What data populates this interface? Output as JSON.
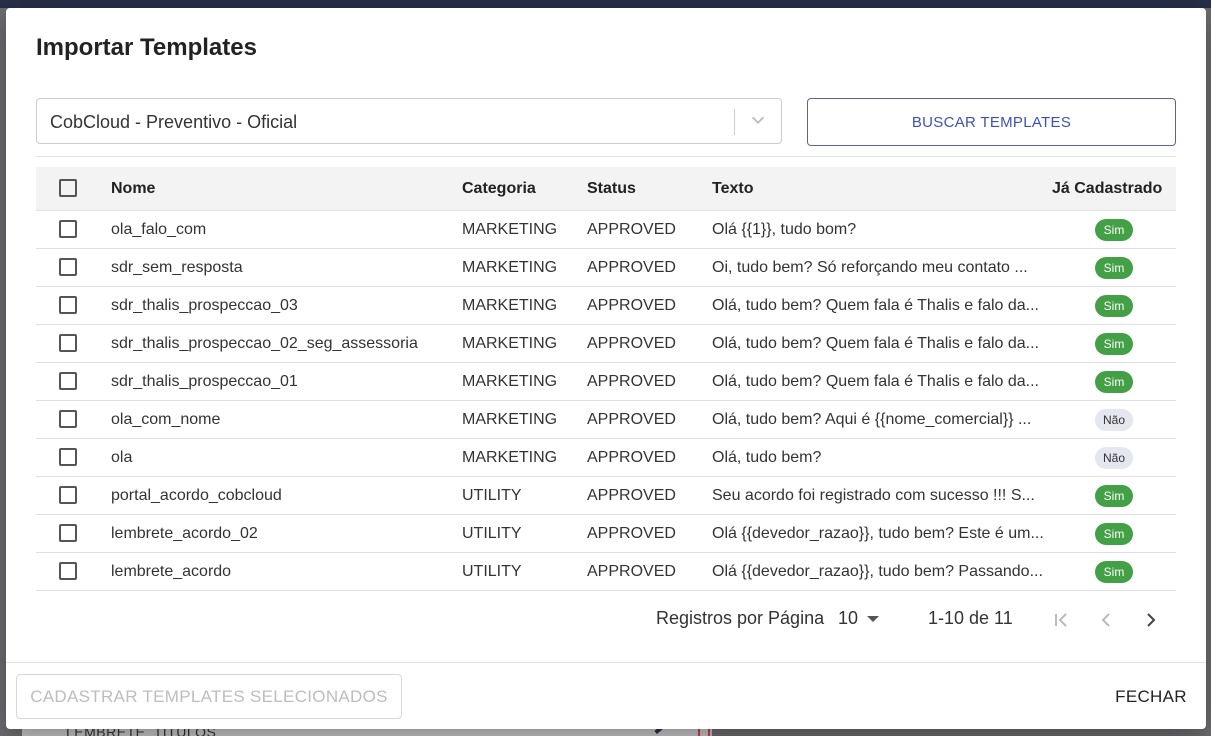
{
  "backdrop": {
    "peek_text": "LEMBRETE_TITULOS"
  },
  "dialog": {
    "title": "Importar Templates",
    "select": {
      "value": "CobCloud - Preventivo - Oficial"
    },
    "buscar_label": "BUSCAR TEMPLATES",
    "table": {
      "headers": {
        "nome": "Nome",
        "categoria": "Categoria",
        "status": "Status",
        "texto": "Texto",
        "cadastrado": "Já Cadastrado"
      },
      "rows": [
        {
          "nome": "ola_falo_com",
          "categoria": "MARKETING",
          "status": "APPROVED",
          "texto": "Olá {{1}}, tudo bom?",
          "cadastrado": "Sim"
        },
        {
          "nome": "sdr_sem_resposta",
          "categoria": "MARKETING",
          "status": "APPROVED",
          "texto": "Oi, tudo bem? Só reforçando meu contato ...",
          "cadastrado": "Sim"
        },
        {
          "nome": "sdr_thalis_prospeccao_03",
          "categoria": "MARKETING",
          "status": "APPROVED",
          "texto": "Olá, tudo bem? Quem fala é Thalis e falo da...",
          "cadastrado": "Sim"
        },
        {
          "nome": "sdr_thalis_prospeccao_02_seg_assessoria",
          "categoria": "MARKETING",
          "status": "APPROVED",
          "texto": "Olá, tudo bem? Quem fala é Thalis e falo da...",
          "cadastrado": "Sim"
        },
        {
          "nome": "sdr_thalis_prospeccao_01",
          "categoria": "MARKETING",
          "status": "APPROVED",
          "texto": "Olá, tudo bem? Quem fala é Thalis e falo da...",
          "cadastrado": "Sim"
        },
        {
          "nome": "ola_com_nome",
          "categoria": "MARKETING",
          "status": "APPROVED",
          "texto": "Olá, tudo bem? Aqui é {{nome_comercial}} ...",
          "cadastrado": "Não"
        },
        {
          "nome": "ola",
          "categoria": "MARKETING",
          "status": "APPROVED",
          "texto": "Olá, tudo bem?",
          "cadastrado": "Não"
        },
        {
          "nome": "portal_acordo_cobcloud",
          "categoria": "UTILITY",
          "status": "APPROVED",
          "texto": "Seu acordo foi registrado com sucesso !!! S...",
          "cadastrado": "Sim"
        },
        {
          "nome": "lembrete_acordo_02",
          "categoria": "UTILITY",
          "status": "APPROVED",
          "texto": "Olá {{devedor_razao}}, tudo bem? Este é um...",
          "cadastrado": "Sim"
        },
        {
          "nome": "lembrete_acordo",
          "categoria": "UTILITY",
          "status": "APPROVED",
          "texto": "Olá {{devedor_razao}}, tudo bem? Passando...",
          "cadastrado": "Sim"
        }
      ]
    },
    "pagination": {
      "rows_per_page_label": "Registros por Página",
      "rows_per_page_value": "10",
      "range": "1-10 de 11"
    },
    "cadastrar_label": "CADASTRAR TEMPLATES SELECIONADOS",
    "fechar_label": "FECHAR",
    "colors": {
      "primary": "#3f51b5",
      "sim_badge": "#43a047",
      "nao_badge": "#e4e6f0"
    }
  }
}
